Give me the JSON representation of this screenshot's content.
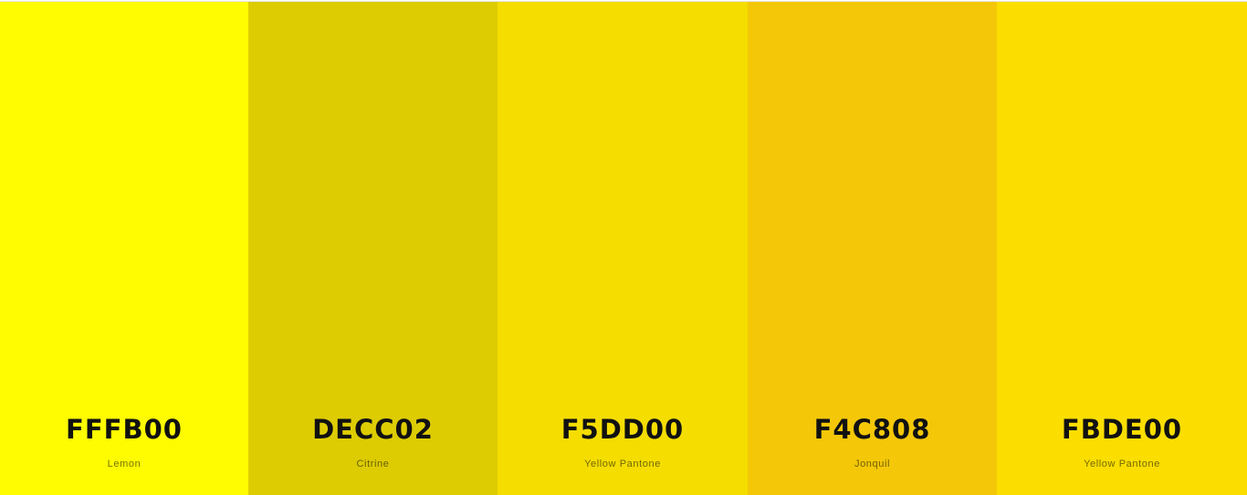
{
  "palette": {
    "swatches": [
      {
        "hex": "FFFB00",
        "name": "Lemon",
        "color": "#FFFB00"
      },
      {
        "hex": "DECC02",
        "name": "Citrine",
        "color": "#DECC02"
      },
      {
        "hex": "F5DD00",
        "name": "Yellow Pantone",
        "color": "#F5DD00"
      },
      {
        "hex": "F4C808",
        "name": "Jonquil",
        "color": "#F4C808"
      },
      {
        "hex": "FBDE00",
        "name": "Yellow Pantone",
        "color": "#FBDE00"
      }
    ]
  }
}
